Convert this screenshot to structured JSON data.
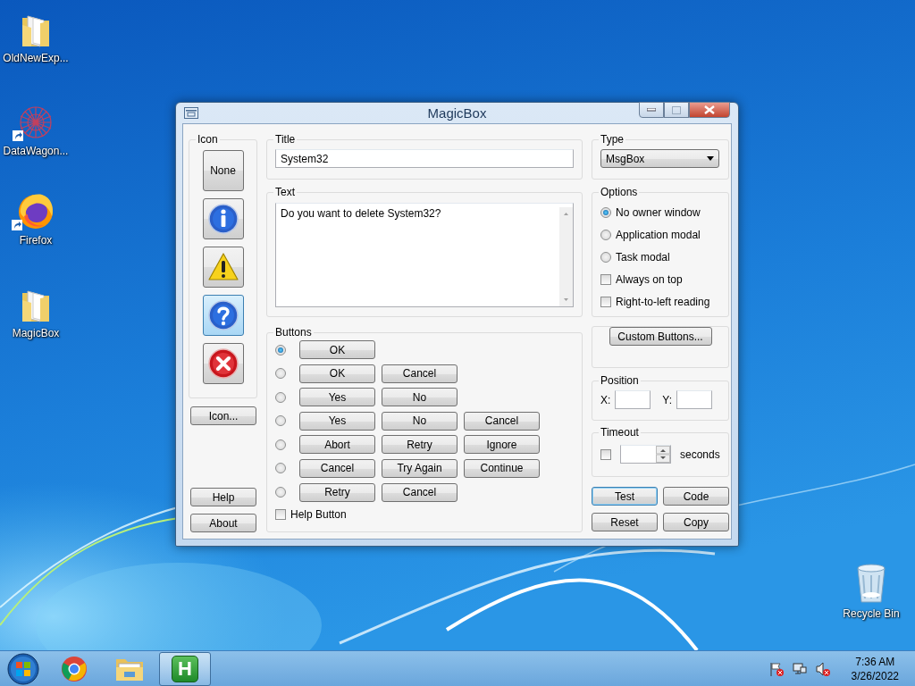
{
  "desktop_icons": [
    {
      "label": "OldNewExp...",
      "kind": "folder",
      "shortcut": false
    },
    {
      "label": "DataWagon...",
      "kind": "graph",
      "shortcut": true
    },
    {
      "label": "Firefox",
      "kind": "browser",
      "shortcut": true
    },
    {
      "label": "MagicBox",
      "kind": "folder",
      "shortcut": false
    },
    {
      "label": "Recycle Bin",
      "kind": "trash",
      "shortcut": false
    }
  ],
  "window": {
    "title": "MagicBox",
    "icon_panel": {
      "label": "Icon",
      "options": [
        {
          "kind": "none",
          "label": "None",
          "selected": false
        },
        {
          "kind": "info",
          "selected": false
        },
        {
          "kind": "warning",
          "selected": false
        },
        {
          "kind": "question",
          "selected": true
        },
        {
          "kind": "error",
          "selected": false
        }
      ],
      "browse_button": "Icon...",
      "help_button": "Help",
      "about_button": "About"
    },
    "title_group": {
      "label": "Title",
      "value": "System32"
    },
    "text_group": {
      "label": "Text",
      "value": "Do you want to delete System32?"
    },
    "buttons_group": {
      "label": "Buttons",
      "rows": [
        {
          "selected": true,
          "buttons": [
            "OK"
          ]
        },
        {
          "selected": false,
          "buttons": [
            "OK",
            "Cancel"
          ]
        },
        {
          "selected": false,
          "buttons": [
            "Yes",
            "No"
          ]
        },
        {
          "selected": false,
          "buttons": [
            "Yes",
            "No",
            "Cancel"
          ]
        },
        {
          "selected": false,
          "buttons": [
            "Abort",
            "Retry",
            "Ignore"
          ]
        },
        {
          "selected": false,
          "buttons": [
            "Cancel",
            "Try Again",
            "Continue"
          ]
        },
        {
          "selected": false,
          "buttons": [
            "Retry",
            "Cancel"
          ]
        }
      ],
      "help_checkbox": {
        "label": "Help Button",
        "checked": false
      }
    },
    "type_group": {
      "label": "Type",
      "value": "MsgBox"
    },
    "options_group": {
      "label": "Options",
      "items": [
        {
          "kind": "radio",
          "label": "No owner window",
          "selected": true
        },
        {
          "kind": "radio",
          "label": "Application modal",
          "selected": false
        },
        {
          "kind": "radio",
          "label": "Task modal",
          "selected": false
        },
        {
          "kind": "check",
          "label": "Always on top",
          "checked": false
        },
        {
          "kind": "check",
          "label": "Right-to-left reading",
          "checked": false
        }
      ]
    },
    "custom_buttons": "Custom Buttons...",
    "position_group": {
      "label": "Position",
      "x_label": "X:",
      "y_label": "Y:"
    },
    "timeout_group": {
      "label": "Timeout",
      "checked": false,
      "unit": "seconds"
    },
    "actions": [
      {
        "label": "Test",
        "default": true
      },
      {
        "label": "Code",
        "default": false
      },
      {
        "label": "Reset",
        "default": false
      },
      {
        "label": "Copy",
        "default": false
      }
    ]
  },
  "taskbar": {
    "apps": [
      {
        "kind": "browser",
        "selected": false
      },
      {
        "kind": "explorer",
        "selected": false
      },
      {
        "kind": "app",
        "label": "H",
        "selected": true
      }
    ],
    "clock": {
      "time": "7:36 AM",
      "date": "3/26/2022"
    }
  }
}
